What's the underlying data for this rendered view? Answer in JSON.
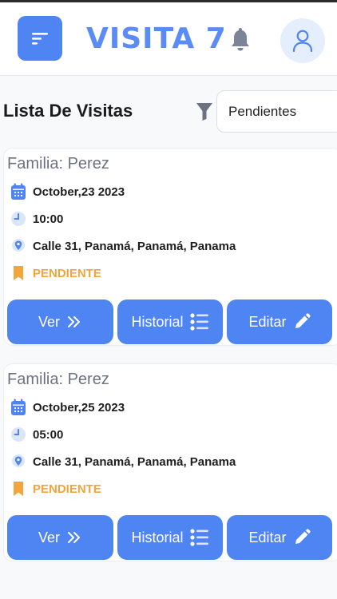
{
  "header": {
    "logo_text": "VISITA 7",
    "menu_icon": "menu-icon",
    "bell_icon": "bell-icon",
    "avatar_icon": "user-icon"
  },
  "main": {
    "title": "Lista De Visitas",
    "filter": {
      "icon": "filter-icon",
      "value": "Pendientes"
    }
  },
  "visits": [
    {
      "family": "Familia: Perez",
      "date": "October,23 2023",
      "time": "10:00",
      "address": "Calle 31, Panamá, Panamá, Panama",
      "status": "PENDIENTE"
    },
    {
      "family": "Familia: Perez",
      "date": "October,25 2023",
      "time": "05:00",
      "address": "Calle 31, Panamá, Panamá, Panama",
      "status": "PENDIENTE"
    }
  ],
  "actions": {
    "view_label": "Ver",
    "history_label": "Historial",
    "edit_label": "Editar"
  },
  "colors": {
    "primary": "#4f84f3",
    "logo": "#5b8cf5",
    "status_pending": "#f2a53c",
    "muted_text": "#6b7382"
  }
}
